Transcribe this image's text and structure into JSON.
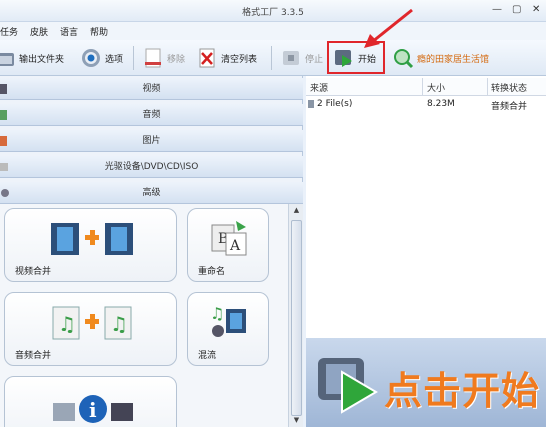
{
  "window": {
    "title": "格式工厂  3.3.5"
  },
  "menu": {
    "items": [
      "任务",
      "皮肤",
      "语言",
      "帮助"
    ]
  },
  "toolbar": {
    "output_folder": "输出文件夹",
    "options": "选项",
    "remove": "移除",
    "clear_list": "清空列表",
    "stop": "停止",
    "start": "开始",
    "promo": "瘾的田家居生活馆"
  },
  "categories": [
    "视频",
    "音频",
    "图片",
    "光驱设备\\DVD\\CD\\ISO",
    "高级"
  ],
  "tiles": {
    "video_merge": "视频合并",
    "rename": "重命名",
    "audio_merge": "音频合并",
    "mix": "混流"
  },
  "table": {
    "headers": [
      "来源",
      "大小",
      "转换状态"
    ],
    "rows": [
      {
        "source": "2 File(s)",
        "size": "8.23M",
        "status": "音频合并"
      }
    ]
  },
  "banner": {
    "text": "点击开始"
  },
  "colors": {
    "accent_orange": "#f07a1e",
    "highlight_red": "#e0262b",
    "panel_blue": "#dfe9f5"
  }
}
